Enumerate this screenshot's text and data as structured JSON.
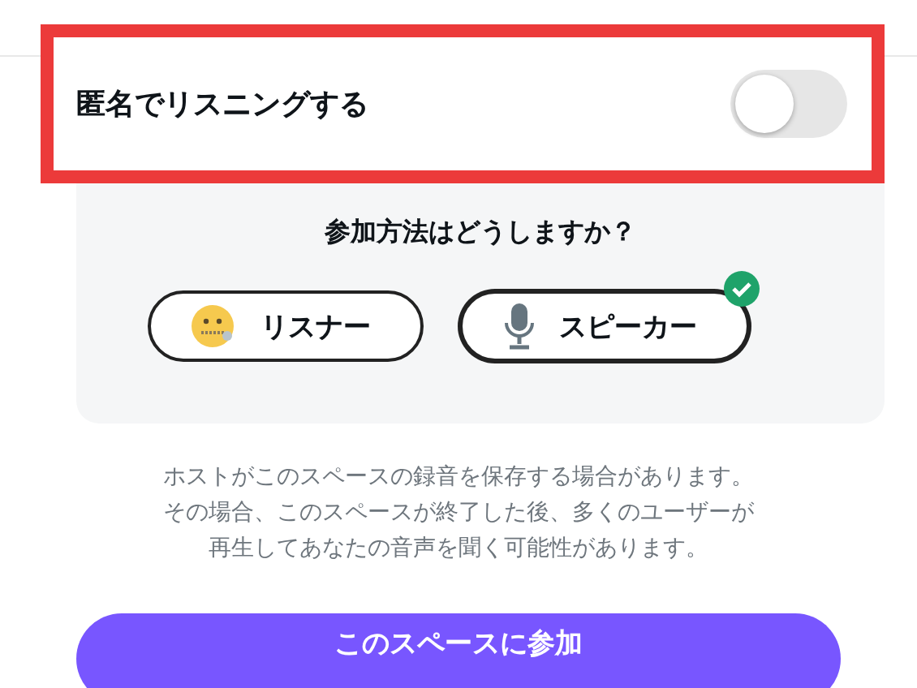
{
  "anonymous_listening": {
    "label": "匿名でリスニングする",
    "on": false
  },
  "join_method": {
    "question": "参加方法はどうしますか？",
    "options": [
      {
        "label": "リスナー",
        "kind": "listener",
        "selected": false
      },
      {
        "label": "スピーカー",
        "kind": "speaker",
        "selected": true
      }
    ]
  },
  "notice_lines": [
    "ホストがこのスペースの録音を保存する場合があります。",
    "その場合、このスペースが終了した後、多くのユーザーが",
    "再生してあなたの音声を聞く可能性があります。"
  ],
  "join_button": "このスペースに参加"
}
